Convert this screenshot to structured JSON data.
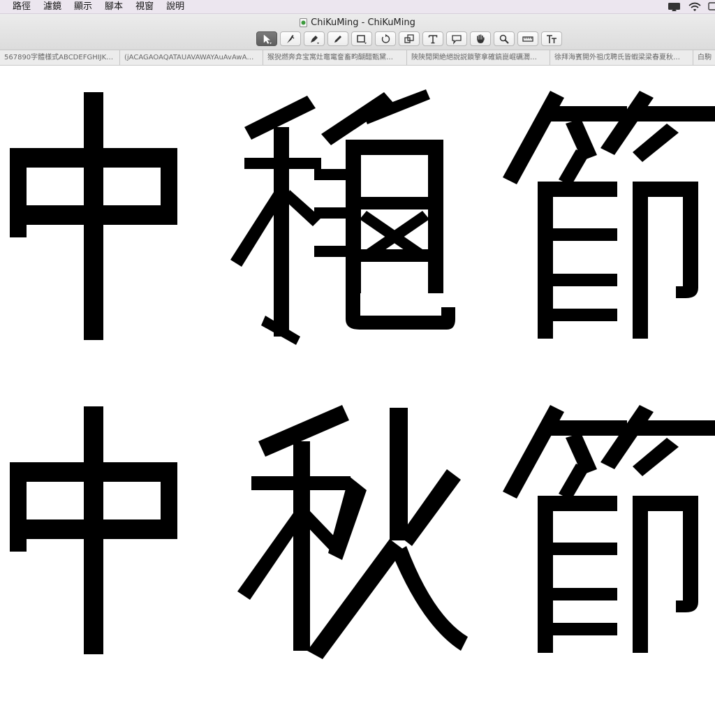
{
  "menubar": {
    "items": [
      "路徑",
      "濾鏡",
      "顯示",
      "腳本",
      "視窗",
      "說明"
    ],
    "status_icons": [
      "airplay-icon",
      "wifi-icon",
      "display-icon"
    ]
  },
  "window": {
    "title": "ChiKuMing - ChiKuMing",
    "doc_icon": "document-icon"
  },
  "toolbar": {
    "tools": [
      {
        "name": "pointer-tool",
        "icon": "arrow-pointer-icon",
        "active": true
      },
      {
        "name": "pen-knife-tool",
        "icon": "knife-icon",
        "active": false
      },
      {
        "name": "pen-tool",
        "icon": "pen-icon",
        "active": false
      },
      {
        "name": "pencil-tool",
        "icon": "pencil-icon",
        "active": false
      },
      {
        "name": "rectangle-tool",
        "icon": "rectangle-icon",
        "active": false
      },
      {
        "name": "rotate-tool",
        "icon": "rotate-icon",
        "active": false
      },
      {
        "name": "scale-tool",
        "icon": "scale-icon",
        "active": false
      },
      {
        "name": "text-tool",
        "icon": "text-t-icon",
        "active": false
      },
      {
        "name": "annotation-tool",
        "icon": "speech-bubble-icon",
        "active": false
      },
      {
        "name": "hand-tool",
        "icon": "hand-icon",
        "active": false
      },
      {
        "name": "zoom-tool",
        "icon": "magnifier-icon",
        "active": false
      },
      {
        "name": "measure-tool",
        "icon": "ruler-icon",
        "active": false
      },
      {
        "name": "text-size-tool",
        "icon": "text-size-icon",
        "active": false
      }
    ]
  },
  "tabs": [
    "567890字體樣式ABCDEFGHIJK…",
    "(jACAGAOAQATAUAVAWAYAuAvAwA…",
    "猴猊燃奔弇宝寓灶竈竃奩畜畇醐醋甄黛…",
    "陜陝閒閑絶絕說説鎖擎拿確鎬崑崐礪濶…",
    "徐拜海賓開外祖戊聘氏皆蝦梁梁春夏秋…",
    "白駒"
  ],
  "canvas": {
    "row1": [
      "中",
      "穐",
      "節"
    ],
    "row2": [
      "中",
      "秋",
      "節"
    ]
  },
  "colors": {
    "menubar_bg": "#ece6ef",
    "toolbar_bg": "#dcdcdc",
    "glyph_fill": "#000000",
    "canvas_bg": "#ffffff"
  }
}
